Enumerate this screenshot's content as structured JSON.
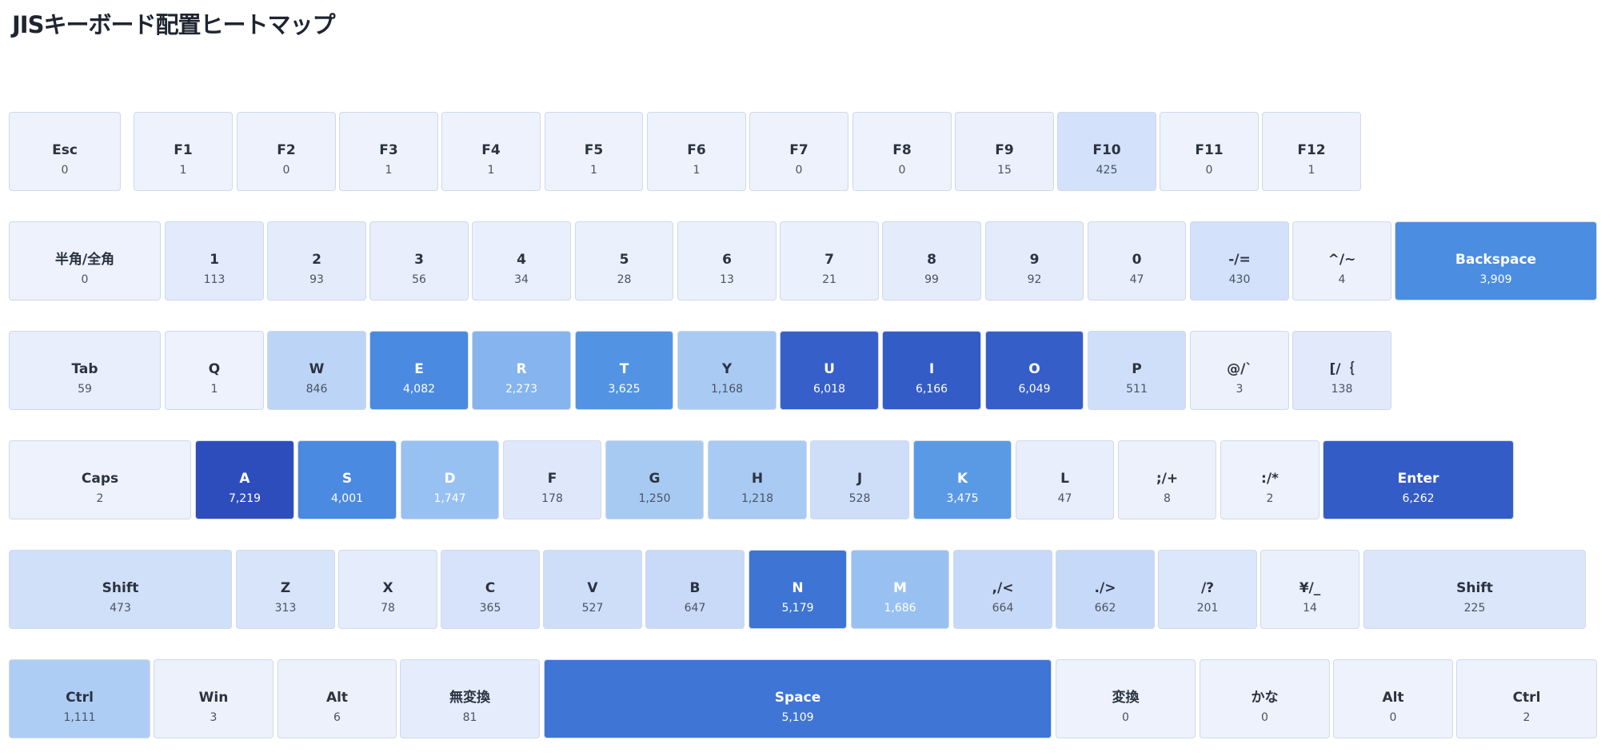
{
  "title": "JISキーボード配置ヒートマップ",
  "colors": {
    "light_text": "#2b3340",
    "light_count": "#4a5363",
    "dark_text": "#ffffff"
  },
  "rows": [
    [
      {
        "label": "Esc",
        "count": "0",
        "color": "#edf2fc"
      },
      {
        "label": "F1",
        "count": "1",
        "color": "#edf2fc"
      },
      {
        "label": "F2",
        "count": "0",
        "color": "#edf2fc"
      },
      {
        "label": "F3",
        "count": "1",
        "color": "#edf2fc"
      },
      {
        "label": "F4",
        "count": "1",
        "color": "#edf2fc"
      },
      {
        "label": "F5",
        "count": "1",
        "color": "#edf2fc"
      },
      {
        "label": "F6",
        "count": "1",
        "color": "#edf2fc"
      },
      {
        "label": "F7",
        "count": "0",
        "color": "#edf2fc"
      },
      {
        "label": "F8",
        "count": "0",
        "color": "#edf2fc"
      },
      {
        "label": "F9",
        "count": "15",
        "color": "#ebf0fc"
      },
      {
        "label": "F10",
        "count": "425",
        "color": "#d3e1fa"
      },
      {
        "label": "F11",
        "count": "0",
        "color": "#edf2fc"
      },
      {
        "label": "F12",
        "count": "1",
        "color": "#edf2fc"
      }
    ],
    [
      {
        "label": "半角/全角",
        "count": "0",
        "color": "#edf2fc"
      },
      {
        "label": "1",
        "count": "113",
        "color": "#e2eafb"
      },
      {
        "label": "2",
        "count": "93",
        "color": "#e4ebfb"
      },
      {
        "label": "3",
        "count": "56",
        "color": "#e8eefc"
      },
      {
        "label": "4",
        "count": "34",
        "color": "#e9effc"
      },
      {
        "label": "5",
        "count": "28",
        "color": "#eaf0fc"
      },
      {
        "label": "6",
        "count": "13",
        "color": "#ebf1fc"
      },
      {
        "label": "7",
        "count": "21",
        "color": "#eaf0fc"
      },
      {
        "label": "8",
        "count": "99",
        "color": "#e4ebfb"
      },
      {
        "label": "9",
        "count": "92",
        "color": "#e4ebfb"
      },
      {
        "label": "0",
        "count": "47",
        "color": "#e8eefc"
      },
      {
        "label": "-/=",
        "count": "430",
        "color": "#d3e1fa"
      },
      {
        "label": "^/~",
        "count": "4",
        "color": "#ecf1fc"
      },
      {
        "label": "Backspace",
        "count": "3,909",
        "color": "#4b8de0"
      }
    ],
    [
      {
        "label": "Tab",
        "count": "59",
        "color": "#e8eefc"
      },
      {
        "label": "Q",
        "count": "1",
        "color": "#edf2fc"
      },
      {
        "label": "W",
        "count": "846",
        "color": "#bcd4f6"
      },
      {
        "label": "E",
        "count": "4,082",
        "color": "#4a8ae0"
      },
      {
        "label": "R",
        "count": "2,273",
        "color": "#85b4ee"
      },
      {
        "label": "T",
        "count": "3,625",
        "color": "#5294e3"
      },
      {
        "label": "Y",
        "count": "1,168",
        "color": "#a9cbf3"
      },
      {
        "label": "U",
        "count": "6,018",
        "color": "#365fc9"
      },
      {
        "label": "I",
        "count": "6,166",
        "color": "#345cc7"
      },
      {
        "label": "O",
        "count": "6,049",
        "color": "#365ec8"
      },
      {
        "label": "P",
        "count": "511",
        "color": "#cfdff9"
      },
      {
        "label": "@/`",
        "count": "3",
        "color": "#ecf1fc"
      },
      {
        "label": "[/｛",
        "count": "138",
        "color": "#e1e9fb"
      }
    ],
    [
      {
        "label": "Caps",
        "count": "2",
        "color": "#edf2fc"
      },
      {
        "label": "A",
        "count": "7,219",
        "color": "#2e4dbd"
      },
      {
        "label": "S",
        "count": "4,001",
        "color": "#4a8ae0"
      },
      {
        "label": "D",
        "count": "1,747",
        "color": "#97c1f1"
      },
      {
        "label": "F",
        "count": "178",
        "color": "#dfe8fb"
      },
      {
        "label": "G",
        "count": "1,250",
        "color": "#a7caf3"
      },
      {
        "label": "H",
        "count": "1,218",
        "color": "#a8caf3"
      },
      {
        "label": "J",
        "count": "528",
        "color": "#cedef9"
      },
      {
        "label": "K",
        "count": "3,475",
        "color": "#5a9ae5"
      },
      {
        "label": "L",
        "count": "47",
        "color": "#e8eefc"
      },
      {
        "label": ";/+",
        "count": "8",
        "color": "#ecf1fc"
      },
      {
        "label": ":/*",
        "count": "2",
        "color": "#edf2fc"
      },
      {
        "label": "Enter",
        "count": "6,262",
        "color": "#345cc7"
      }
    ],
    [
      {
        "label": "Shift",
        "count": "473",
        "color": "#d1e0f9"
      },
      {
        "label": "Z",
        "count": "313",
        "color": "#d8e4fa"
      },
      {
        "label": "X",
        "count": "78",
        "color": "#e5ecfb"
      },
      {
        "label": "C",
        "count": "365",
        "color": "#d6e3fa"
      },
      {
        "label": "V",
        "count": "527",
        "color": "#cedef9"
      },
      {
        "label": "B",
        "count": "647",
        "color": "#c8daf8"
      },
      {
        "label": "N",
        "count": "5,179",
        "color": "#3e74d4"
      },
      {
        "label": "M",
        "count": "1,686",
        "color": "#98c1f1"
      },
      {
        "label": ",/<",
        "count": "664",
        "color": "#c7d9f8"
      },
      {
        "label": "./>",
        "count": "662",
        "color": "#c7d9f8"
      },
      {
        "label": "/?",
        "count": "201",
        "color": "#dde7fb"
      },
      {
        "label": "¥/_",
        "count": "14",
        "color": "#ebf1fc"
      },
      {
        "label": "Shift",
        "count": "225",
        "color": "#dce6fb"
      }
    ],
    [
      {
        "label": "Ctrl",
        "count": "1,111",
        "color": "#aecdf4"
      },
      {
        "label": "Win",
        "count": "3",
        "color": "#ecf1fc"
      },
      {
        "label": "Alt",
        "count": "6",
        "color": "#ecf1fc"
      },
      {
        "label": "無変換",
        "count": "81",
        "color": "#e5ecfb"
      },
      {
        "label": "Space",
        "count": "5,109",
        "color": "#3f75d5"
      },
      {
        "label": "変換",
        "count": "0",
        "color": "#edf2fc"
      },
      {
        "label": "かな",
        "count": "0",
        "color": "#edf2fc"
      },
      {
        "label": "Alt",
        "count": "0",
        "color": "#edf2fc"
      },
      {
        "label": "Ctrl",
        "count": "2",
        "color": "#edf2fc"
      }
    ]
  ]
}
